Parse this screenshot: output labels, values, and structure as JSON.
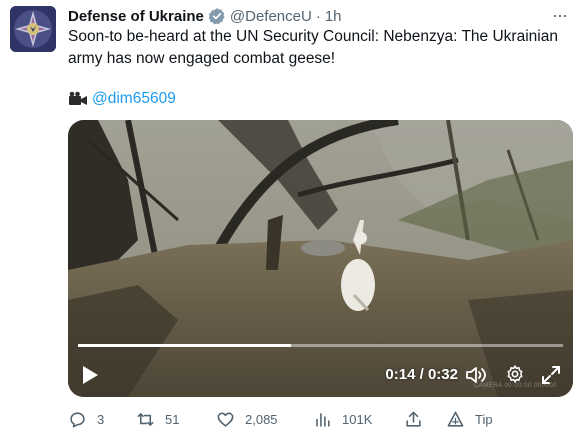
{
  "tweet": {
    "author_name": "Defense of Ukraine",
    "handle": "@DefenceU",
    "separator": "·",
    "time": "1h",
    "more_label": "···",
    "text": "Soon-to be-heard at the UN Security Council: Nebenzya: The Ukrainian army has now engaged combat geese!",
    "credit_icon": "video-camera-icon",
    "credit_mention": "@dim65609"
  },
  "video": {
    "current_time": "0:14",
    "time_separator": " / ",
    "duration": "0:32",
    "progress": 0.44,
    "watermark": "CAMERA 00:00:00 000000"
  },
  "actions": {
    "replies": "3",
    "retweets": "51",
    "likes": "2,085",
    "views": "101K",
    "tip": "Tip"
  },
  "colors": {
    "link": "#1d9bf0",
    "secondary_text": "#536471",
    "verified": "#829aab"
  }
}
